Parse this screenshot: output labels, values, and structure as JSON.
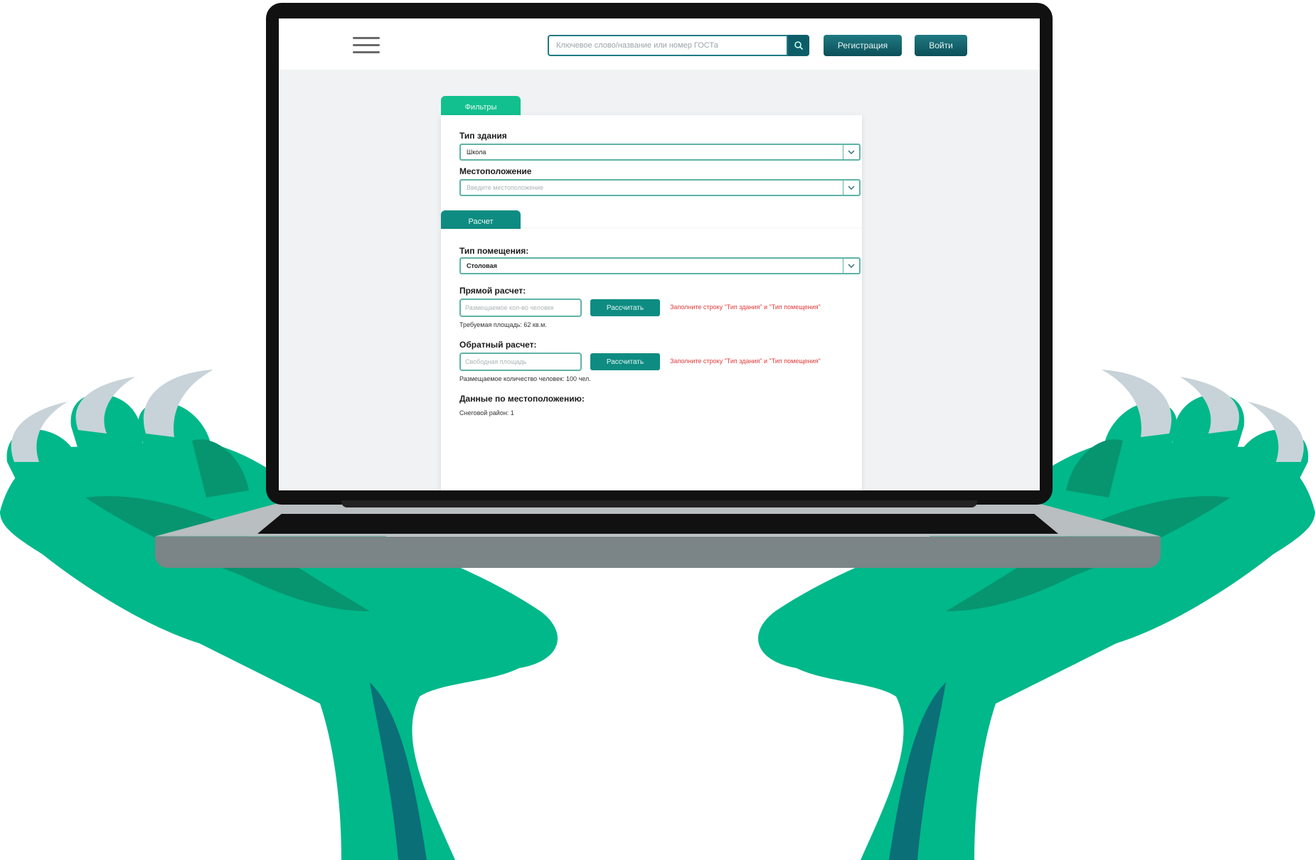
{
  "header": {
    "search_placeholder": "Ключевое слово/название или номер ГОСТа",
    "register_label": "Регистрация",
    "login_label": "Войти"
  },
  "filters": {
    "tab_label": "Фильтры",
    "building_type_label": "Тип здания",
    "building_type_value": "Школа",
    "location_label": "Местоположение",
    "location_placeholder": "Введите местоположение"
  },
  "calc": {
    "tab_label": "Расчет",
    "room_type_label": "Тип помещения:",
    "room_type_value": "Столовая",
    "direct_label": "Прямой расчет:",
    "direct_placeholder": "Размещаемое кол-во человек",
    "direct_button": "Рассчитать",
    "direct_error": "Заполните строку \"Тип здания\" и \"Тип помещения\"",
    "direct_result": "Требуемая площадь:   62 кв.м.",
    "reverse_label": "Обратный расчет:",
    "reverse_placeholder": "Свободная площадь",
    "reverse_button": "Рассчитать",
    "reverse_error": "Заполните строку \"Тип здания\" и \"Тип помещения\"",
    "reverse_result": "Размещаемое количество человек:   100 чел.",
    "location_data_label": "Данные по местоположению:",
    "snow_region": "Снеговой район:   1"
  },
  "colors": {
    "hand": "#00b88a",
    "hand_shadow": "#079570",
    "hand_dark": "#0b6f78",
    "claw": "#c7d3d9",
    "accent": "#0e8c82",
    "error": "#e03a3a"
  },
  "icons": [
    "hamburger-icon",
    "search-icon",
    "chevron-down-icon",
    "claw-icon"
  ]
}
